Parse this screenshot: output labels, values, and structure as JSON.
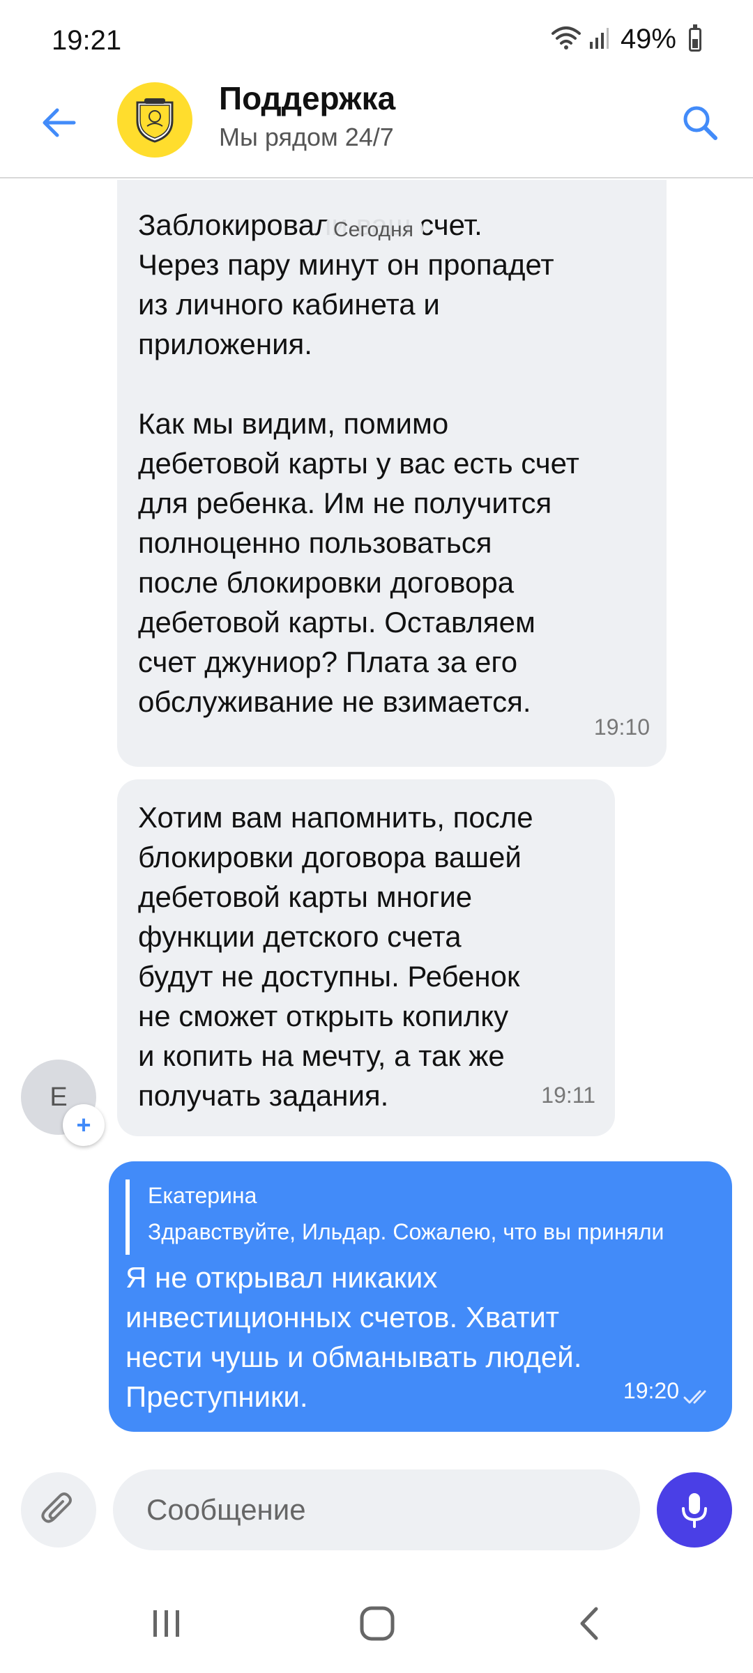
{
  "status_bar": {
    "time": "19:21",
    "battery": "49%"
  },
  "header": {
    "title": "Поддержка",
    "subtitle": "Мы рядом 24/7"
  },
  "chat": {
    "date_label": "Сегодня",
    "messages": [
      {
        "direction": "incoming",
        "text": "Заблокировали ваш счет.\nЧерез пару минут он пропадет\nиз личного кабинета и\nприложения.\n\nКак мы видим, помимо\nдебетовой карты у вас есть счет\nдля ребенка. Им не получится\nполноценно пользоваться\nпосле блокировки договора\nдебетовой карты. Оставляем\nсчет джуниор? Плата за его\nобслуживание не взимается.",
        "time": "19:10"
      },
      {
        "direction": "incoming",
        "text": "Хотим вам напомнить, после\nблокировки договора вашей\nдебетовой карты многие\nфункции детского счета\nбудут не доступны. Ребенок\nне сможет открыть копилку\nи копить на мечту, а так же\nполучать задания.",
        "time": "19:11",
        "sender_initial": "Е"
      },
      {
        "direction": "outgoing",
        "reply_to": {
          "name": "Екатерина",
          "text": "Здравствуйте, Ильдар. Сожалею, что вы приняли"
        },
        "text": "Я не открывал никаких\nинвестиционных счетов. Хватит\nнести чушь и обманывать людей.\nПреступники.",
        "time": "19:20",
        "status": "read"
      }
    ]
  },
  "composer": {
    "placeholder": "Сообщение"
  },
  "colors": {
    "accent": "#428bf9",
    "brand_yellow": "#ffdd2d",
    "incoming_bubble": "#eef0f3",
    "mic_button": "#4a3fe6"
  },
  "icons": {
    "back": "arrow-left-icon",
    "search": "search-icon",
    "attach": "paperclip-icon",
    "mic": "microphone-icon",
    "nav_recents": "recents-icon",
    "nav_home": "home-icon",
    "nav_back": "back-chevron-icon"
  }
}
